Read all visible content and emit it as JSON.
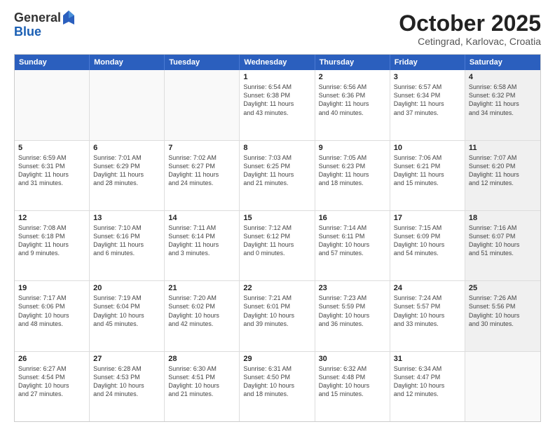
{
  "logo": {
    "general": "General",
    "blue": "Blue"
  },
  "header": {
    "month": "October 2025",
    "location": "Cetingrad, Karlovac, Croatia"
  },
  "days": [
    "Sunday",
    "Monday",
    "Tuesday",
    "Wednesday",
    "Thursday",
    "Friday",
    "Saturday"
  ],
  "weeks": [
    [
      {
        "day": "",
        "info": ""
      },
      {
        "day": "",
        "info": ""
      },
      {
        "day": "",
        "info": ""
      },
      {
        "day": "1",
        "info": "Sunrise: 6:54 AM\nSunset: 6:38 PM\nDaylight: 11 hours\nand 43 minutes."
      },
      {
        "day": "2",
        "info": "Sunrise: 6:56 AM\nSunset: 6:36 PM\nDaylight: 11 hours\nand 40 minutes."
      },
      {
        "day": "3",
        "info": "Sunrise: 6:57 AM\nSunset: 6:34 PM\nDaylight: 11 hours\nand 37 minutes."
      },
      {
        "day": "4",
        "info": "Sunrise: 6:58 AM\nSunset: 6:32 PM\nDaylight: 11 hours\nand 34 minutes."
      }
    ],
    [
      {
        "day": "5",
        "info": "Sunrise: 6:59 AM\nSunset: 6:31 PM\nDaylight: 11 hours\nand 31 minutes."
      },
      {
        "day": "6",
        "info": "Sunrise: 7:01 AM\nSunset: 6:29 PM\nDaylight: 11 hours\nand 28 minutes."
      },
      {
        "day": "7",
        "info": "Sunrise: 7:02 AM\nSunset: 6:27 PM\nDaylight: 11 hours\nand 24 minutes."
      },
      {
        "day": "8",
        "info": "Sunrise: 7:03 AM\nSunset: 6:25 PM\nDaylight: 11 hours\nand 21 minutes."
      },
      {
        "day": "9",
        "info": "Sunrise: 7:05 AM\nSunset: 6:23 PM\nDaylight: 11 hours\nand 18 minutes."
      },
      {
        "day": "10",
        "info": "Sunrise: 7:06 AM\nSunset: 6:21 PM\nDaylight: 11 hours\nand 15 minutes."
      },
      {
        "day": "11",
        "info": "Sunrise: 7:07 AM\nSunset: 6:20 PM\nDaylight: 11 hours\nand 12 minutes."
      }
    ],
    [
      {
        "day": "12",
        "info": "Sunrise: 7:08 AM\nSunset: 6:18 PM\nDaylight: 11 hours\nand 9 minutes."
      },
      {
        "day": "13",
        "info": "Sunrise: 7:10 AM\nSunset: 6:16 PM\nDaylight: 11 hours\nand 6 minutes."
      },
      {
        "day": "14",
        "info": "Sunrise: 7:11 AM\nSunset: 6:14 PM\nDaylight: 11 hours\nand 3 minutes."
      },
      {
        "day": "15",
        "info": "Sunrise: 7:12 AM\nSunset: 6:12 PM\nDaylight: 11 hours\nand 0 minutes."
      },
      {
        "day": "16",
        "info": "Sunrise: 7:14 AM\nSunset: 6:11 PM\nDaylight: 10 hours\nand 57 minutes."
      },
      {
        "day": "17",
        "info": "Sunrise: 7:15 AM\nSunset: 6:09 PM\nDaylight: 10 hours\nand 54 minutes."
      },
      {
        "day": "18",
        "info": "Sunrise: 7:16 AM\nSunset: 6:07 PM\nDaylight: 10 hours\nand 51 minutes."
      }
    ],
    [
      {
        "day": "19",
        "info": "Sunrise: 7:17 AM\nSunset: 6:06 PM\nDaylight: 10 hours\nand 48 minutes."
      },
      {
        "day": "20",
        "info": "Sunrise: 7:19 AM\nSunset: 6:04 PM\nDaylight: 10 hours\nand 45 minutes."
      },
      {
        "day": "21",
        "info": "Sunrise: 7:20 AM\nSunset: 6:02 PM\nDaylight: 10 hours\nand 42 minutes."
      },
      {
        "day": "22",
        "info": "Sunrise: 7:21 AM\nSunset: 6:01 PM\nDaylight: 10 hours\nand 39 minutes."
      },
      {
        "day": "23",
        "info": "Sunrise: 7:23 AM\nSunset: 5:59 PM\nDaylight: 10 hours\nand 36 minutes."
      },
      {
        "day": "24",
        "info": "Sunrise: 7:24 AM\nSunset: 5:57 PM\nDaylight: 10 hours\nand 33 minutes."
      },
      {
        "day": "25",
        "info": "Sunrise: 7:26 AM\nSunset: 5:56 PM\nDaylight: 10 hours\nand 30 minutes."
      }
    ],
    [
      {
        "day": "26",
        "info": "Sunrise: 6:27 AM\nSunset: 4:54 PM\nDaylight: 10 hours\nand 27 minutes."
      },
      {
        "day": "27",
        "info": "Sunrise: 6:28 AM\nSunset: 4:53 PM\nDaylight: 10 hours\nand 24 minutes."
      },
      {
        "day": "28",
        "info": "Sunrise: 6:30 AM\nSunset: 4:51 PM\nDaylight: 10 hours\nand 21 minutes."
      },
      {
        "day": "29",
        "info": "Sunrise: 6:31 AM\nSunset: 4:50 PM\nDaylight: 10 hours\nand 18 minutes."
      },
      {
        "day": "30",
        "info": "Sunrise: 6:32 AM\nSunset: 4:48 PM\nDaylight: 10 hours\nand 15 minutes."
      },
      {
        "day": "31",
        "info": "Sunrise: 6:34 AM\nSunset: 4:47 PM\nDaylight: 10 hours\nand 12 minutes."
      },
      {
        "day": "",
        "info": ""
      }
    ]
  ]
}
